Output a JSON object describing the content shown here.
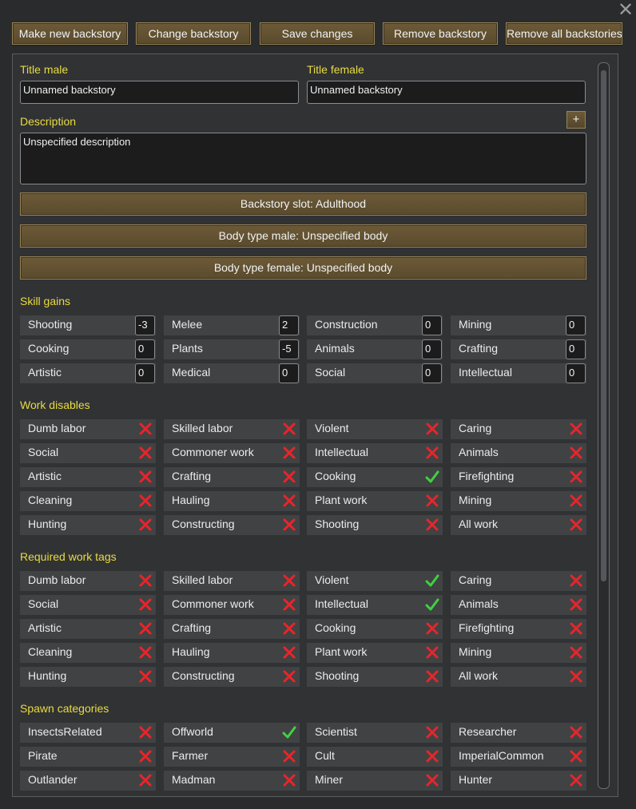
{
  "top_buttons": [
    "Make new backstory",
    "Change backstory",
    "Save changes",
    "Remove backstory",
    "Remove all backstories"
  ],
  "title_male": {
    "label": "Title male",
    "value": "Unnamed backstory"
  },
  "title_female": {
    "label": "Title female",
    "value": "Unnamed backstory"
  },
  "description": {
    "label": "Description",
    "value": "Unspecified description",
    "add_label": "+"
  },
  "slot_buttons": [
    "Backstory slot: Adulthood",
    "Body type male: Unspecified body",
    "Body type female: Unspecified body"
  ],
  "skill_gains": {
    "label": "Skill gains",
    "items": [
      {
        "name": "Shooting",
        "value": "-3"
      },
      {
        "name": "Melee",
        "value": "2"
      },
      {
        "name": "Construction",
        "value": "0"
      },
      {
        "name": "Mining",
        "value": "0"
      },
      {
        "name": "Cooking",
        "value": "0"
      },
      {
        "name": "Plants",
        "value": "-5"
      },
      {
        "name": "Animals",
        "value": "0"
      },
      {
        "name": "Crafting",
        "value": "0"
      },
      {
        "name": "Artistic",
        "value": "0"
      },
      {
        "name": "Medical",
        "value": "0"
      },
      {
        "name": "Social",
        "value": "0"
      },
      {
        "name": "Intellectual",
        "value": "0"
      }
    ]
  },
  "work_disables": {
    "label": "Work disables",
    "items": [
      {
        "name": "Dumb labor",
        "checked": false
      },
      {
        "name": "Skilled labor",
        "checked": false
      },
      {
        "name": "Violent",
        "checked": false
      },
      {
        "name": "Caring",
        "checked": false
      },
      {
        "name": "Social",
        "checked": false
      },
      {
        "name": "Commoner work",
        "checked": false
      },
      {
        "name": "Intellectual",
        "checked": false
      },
      {
        "name": "Animals",
        "checked": false
      },
      {
        "name": "Artistic",
        "checked": false
      },
      {
        "name": "Crafting",
        "checked": false
      },
      {
        "name": "Cooking",
        "checked": true
      },
      {
        "name": "Firefighting",
        "checked": false
      },
      {
        "name": "Cleaning",
        "checked": false
      },
      {
        "name": "Hauling",
        "checked": false
      },
      {
        "name": "Plant work",
        "checked": false
      },
      {
        "name": "Mining",
        "checked": false
      },
      {
        "name": "Hunting",
        "checked": false
      },
      {
        "name": "Constructing",
        "checked": false
      },
      {
        "name": "Shooting",
        "checked": false
      },
      {
        "name": "All work",
        "checked": false
      }
    ]
  },
  "required_work_tags": {
    "label": "Required work tags",
    "items": [
      {
        "name": "Dumb labor",
        "checked": false
      },
      {
        "name": "Skilled labor",
        "checked": false
      },
      {
        "name": "Violent",
        "checked": true
      },
      {
        "name": "Caring",
        "checked": false
      },
      {
        "name": "Social",
        "checked": false
      },
      {
        "name": "Commoner work",
        "checked": false
      },
      {
        "name": "Intellectual",
        "checked": true
      },
      {
        "name": "Animals",
        "checked": false
      },
      {
        "name": "Artistic",
        "checked": false
      },
      {
        "name": "Crafting",
        "checked": false
      },
      {
        "name": "Cooking",
        "checked": false
      },
      {
        "name": "Firefighting",
        "checked": false
      },
      {
        "name": "Cleaning",
        "checked": false
      },
      {
        "name": "Hauling",
        "checked": false
      },
      {
        "name": "Plant work",
        "checked": false
      },
      {
        "name": "Mining",
        "checked": false
      },
      {
        "name": "Hunting",
        "checked": false
      },
      {
        "name": "Constructing",
        "checked": false
      },
      {
        "name": "Shooting",
        "checked": false
      },
      {
        "name": "All work",
        "checked": false
      }
    ]
  },
  "spawn_categories": {
    "label": "Spawn categories",
    "items": [
      {
        "name": "InsectsRelated",
        "checked": false
      },
      {
        "name": "Offworld",
        "checked": true
      },
      {
        "name": "Scientist",
        "checked": false
      },
      {
        "name": "Researcher",
        "checked": false
      },
      {
        "name": "Pirate",
        "checked": false
      },
      {
        "name": "Farmer",
        "checked": false
      },
      {
        "name": "Cult",
        "checked": false
      },
      {
        "name": "ImperialCommon",
        "checked": false
      },
      {
        "name": "Outlander",
        "checked": false
      },
      {
        "name": "Madman",
        "checked": false
      },
      {
        "name": "Miner",
        "checked": false
      },
      {
        "name": "Hunter",
        "checked": false
      }
    ]
  },
  "colors": {
    "accent_label": "#e8dc40",
    "check": "#3fd23f",
    "cross": "#e8252a",
    "button": "#6c5a37"
  }
}
